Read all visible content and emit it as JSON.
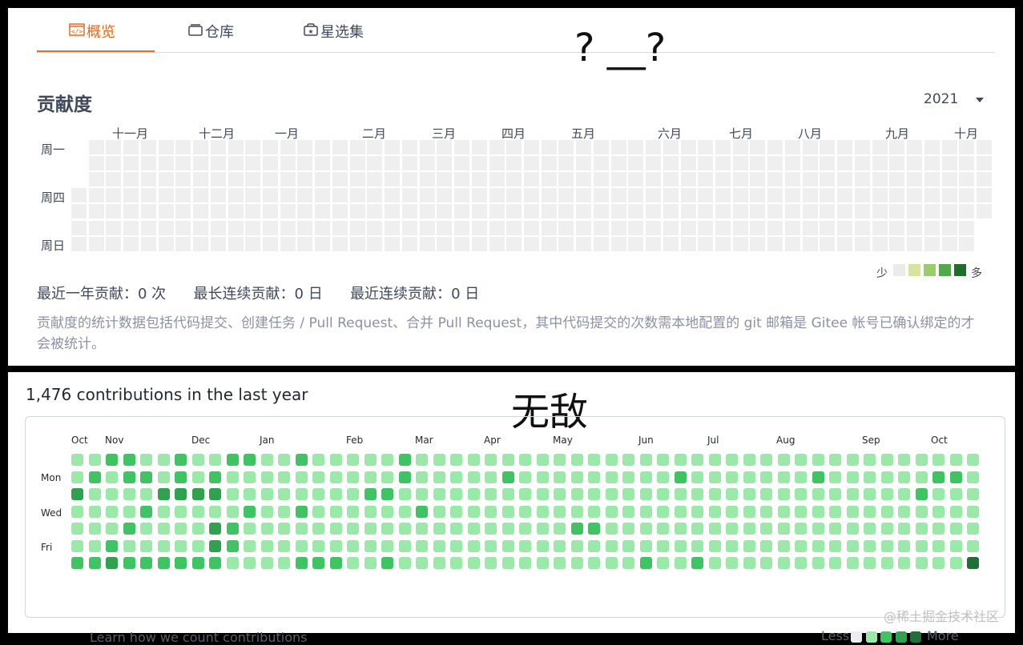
{
  "gitee": {
    "tabs": [
      {
        "label": "概览",
        "icon": "code-window-icon",
        "active": true
      },
      {
        "label": "仓库",
        "icon": "repository-icon",
        "active": false
      },
      {
        "label": "星选集",
        "icon": "star-collection-icon",
        "active": false
      }
    ],
    "meme_top": "? __?",
    "title": "贡献度",
    "year": "2021",
    "months": [
      "十一月",
      "十二月",
      "一月",
      "二月",
      "三月",
      "四月",
      "五月",
      "六月",
      "七月",
      "八月",
      "九月",
      "十月"
    ],
    "day_labels": [
      "周一",
      "周四",
      "周日"
    ],
    "legend_less": "少",
    "legend_more": "多",
    "legend_colors": [
      "#ebebeb",
      "#d5e4a1",
      "#9ccb6b",
      "#52a84b",
      "#1e6d2b"
    ],
    "cell_color": "#efefef",
    "stats": {
      "year_label": "最近一年贡献：",
      "year_value": "0 次",
      "longest_label": "最长连续贡献：",
      "longest_value": "0 日",
      "recent_label": "最近连续贡献：",
      "recent_value": "0 日"
    },
    "note": "贡献度的统计数据包括代码提交、创建任务 / Pull Request、合并 Pull Request，其中代码提交的次数需本地配置的 git 邮箱是 Gitee 帐号已确认绑定的才会被统计。"
  },
  "github": {
    "title": "1,476 contributions in the last year",
    "meme": "无敌",
    "months": [
      "Oct",
      "Nov",
      "Dec",
      "Jan",
      "Feb",
      "Mar",
      "Apr",
      "May",
      "Jun",
      "Jul",
      "Aug",
      "Sep",
      "Oct"
    ],
    "day_labels": [
      "Mon",
      "Wed",
      "Fri"
    ],
    "learn": "Learn how we count contributions",
    "legend_less": "Less",
    "legend_more": "More",
    "colors": [
      "#ebedf0",
      "#9be9a8",
      "#40c463",
      "#30a14e",
      "#216e39"
    ],
    "grid": [
      [
        1,
        1,
        2,
        2,
        1,
        1,
        2,
        1,
        1,
        2,
        2,
        1,
        1,
        2,
        1,
        1,
        1,
        1,
        1,
        2,
        1,
        1,
        1,
        1,
        1,
        1,
        1,
        1,
        1,
        1,
        1,
        1,
        1,
        1,
        1,
        1,
        1,
        1,
        1,
        1,
        1,
        1,
        1,
        1,
        1,
        1,
        1,
        1,
        1,
        1,
        1,
        1,
        1
      ],
      [
        1,
        2,
        1,
        2,
        2,
        1,
        2,
        1,
        2,
        1,
        1,
        1,
        1,
        1,
        1,
        1,
        1,
        1,
        1,
        2,
        1,
        1,
        1,
        1,
        1,
        2,
        1,
        1,
        1,
        1,
        1,
        1,
        1,
        1,
        1,
        2,
        1,
        1,
        1,
        1,
        1,
        1,
        1,
        2,
        1,
        1,
        1,
        1,
        1,
        1,
        2,
        2,
        1
      ],
      [
        3,
        1,
        1,
        1,
        1,
        3,
        3,
        3,
        3,
        1,
        1,
        1,
        1,
        1,
        1,
        1,
        1,
        2,
        2,
        1,
        1,
        1,
        1,
        1,
        1,
        1,
        1,
        1,
        1,
        1,
        1,
        1,
        1,
        1,
        1,
        1,
        1,
        1,
        1,
        1,
        1,
        1,
        1,
        1,
        1,
        1,
        1,
        1,
        1,
        2,
        1,
        1,
        1
      ],
      [
        1,
        1,
        1,
        1,
        2,
        1,
        1,
        1,
        1,
        1,
        2,
        1,
        1,
        2,
        1,
        1,
        1,
        1,
        1,
        1,
        2,
        1,
        1,
        1,
        1,
        1,
        1,
        1,
        1,
        1,
        1,
        1,
        1,
        1,
        1,
        1,
        1,
        1,
        1,
        1,
        1,
        1,
        1,
        1,
        1,
        1,
        1,
        1,
        1,
        1,
        1,
        1,
        1
      ],
      [
        1,
        1,
        1,
        2,
        1,
        1,
        1,
        1,
        3,
        2,
        1,
        1,
        1,
        1,
        1,
        1,
        1,
        1,
        1,
        1,
        1,
        1,
        1,
        1,
        1,
        1,
        1,
        1,
        1,
        2,
        2,
        1,
        1,
        1,
        1,
        1,
        1,
        1,
        1,
        1,
        1,
        1,
        1,
        1,
        1,
        1,
        1,
        1,
        1,
        1,
        1,
        1,
        1
      ],
      [
        1,
        1,
        2,
        1,
        1,
        1,
        1,
        1,
        3,
        2,
        1,
        1,
        1,
        1,
        1,
        1,
        1,
        1,
        1,
        1,
        1,
        1,
        1,
        1,
        1,
        1,
        1,
        1,
        1,
        1,
        1,
        1,
        1,
        1,
        1,
        1,
        1,
        1,
        1,
        1,
        1,
        1,
        1,
        1,
        1,
        1,
        1,
        1,
        1,
        1,
        1,
        1,
        1
      ],
      [
        2,
        2,
        3,
        2,
        2,
        2,
        2,
        2,
        2,
        1,
        1,
        1,
        1,
        2,
        2,
        2,
        1,
        1,
        2,
        1,
        1,
        1,
        1,
        1,
        1,
        1,
        1,
        1,
        1,
        1,
        1,
        1,
        1,
        2,
        1,
        1,
        2,
        1,
        1,
        1,
        1,
        1,
        1,
        1,
        1,
        1,
        1,
        1,
        1,
        1,
        1,
        1,
        4
      ]
    ],
    "watermark": "@稀土掘金技术社区"
  }
}
